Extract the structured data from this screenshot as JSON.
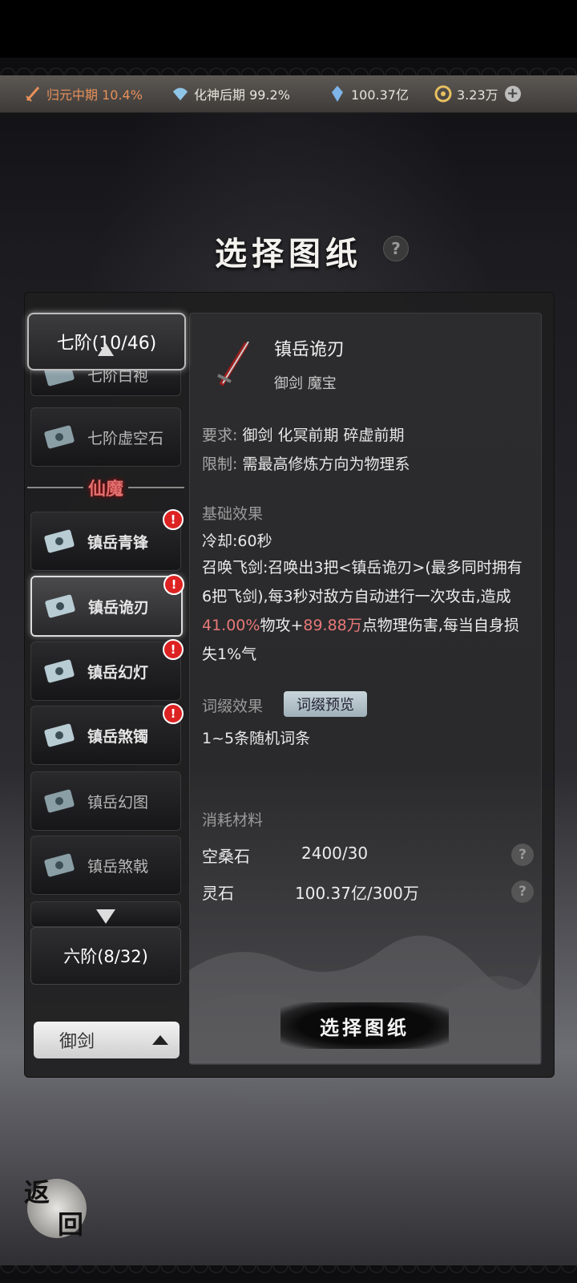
{
  "resources": [
    {
      "icon": "sword-icon",
      "value": "归元中期 10.4%",
      "color": "#e8905a"
    },
    {
      "icon": "fan-icon",
      "value": "化神后期 99.2%",
      "color": "#e8e4dc"
    },
    {
      "icon": "crystal-icon",
      "value": "100.37亿",
      "color": "#e8e4dc"
    },
    {
      "icon": "coin-icon",
      "value": "3.23万",
      "color": "#e8e4dc"
    }
  ],
  "plus_label": "+",
  "title": "选择图纸",
  "title_help": "?",
  "tier7_label": "七阶(10/46)",
  "list_items": [
    {
      "label": "七阶白袍",
      "state": "partial"
    },
    {
      "label": "七阶虚空石",
      "state": "normal"
    },
    {
      "label": "镇岳青锋",
      "badge": "!"
    },
    {
      "label": "镇岳诡刃",
      "badge": "!",
      "selected": true
    },
    {
      "label": "镇岳幻灯",
      "badge": "!"
    },
    {
      "label": "镇岳煞镯",
      "badge": "!"
    },
    {
      "label": "镇岳幻图"
    },
    {
      "label": "镇岳煞戟"
    }
  ],
  "divider_label": "仙魔",
  "tier6_label": "六阶(8/32)",
  "category_select": "御剑",
  "detail": {
    "name": "镇岳诡刃",
    "tags": "御剑  魔宝",
    "req_key": "要求:",
    "req_val": "御剑  化冥前期  碎虚前期",
    "limit_key": "限制:",
    "limit_val": "需最高修炼方向为物理系",
    "base_title": "基础效果",
    "cooldown": "冷却:60秒",
    "desc_a": "召唤飞剑:召唤出3把<镇岳诡刃>(最多同时拥有6把飞剑),每3秒对敌方自动进行一次攻击,造成",
    "desc_pct": "41.00%",
    "desc_b": "物攻+",
    "desc_amt": "89.88万",
    "desc_c": "点物理伤害,每当自身损失1%气",
    "affix_title": "词缀效果",
    "affix_preview": "词缀预览",
    "affix_text": "1~5条随机词条",
    "mat_title": "消耗材料",
    "materials": [
      {
        "name": "空桑石",
        "qty": "2400/30"
      },
      {
        "name": "灵石",
        "qty": "100.37亿/300万"
      }
    ],
    "select_button": "选择图纸"
  },
  "back_char1": "返",
  "back_char2": "回"
}
